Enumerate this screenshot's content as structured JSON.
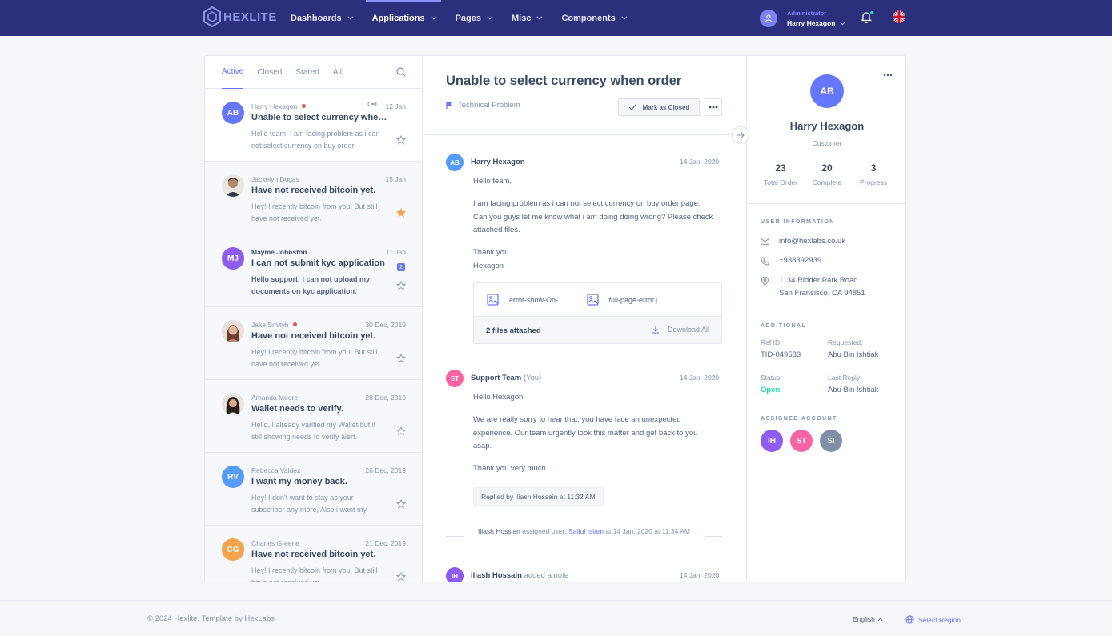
{
  "brand": {
    "name": "HEXLITE"
  },
  "nav": [
    {
      "label": "Dashboards"
    },
    {
      "label": "Applications",
      "active": true
    },
    {
      "label": "Pages"
    },
    {
      "label": "Misc"
    },
    {
      "label": "Components"
    }
  ],
  "user": {
    "role": "Administrator",
    "name": "Harry Hexagon"
  },
  "tabs": [
    {
      "label": "Active",
      "active": true
    },
    {
      "label": "Closed"
    },
    {
      "label": "Stared"
    },
    {
      "label": "All"
    }
  ],
  "messages": [
    {
      "initials": "AB",
      "color": "#6576ff",
      "name": "Harry Hexagon",
      "unread": true,
      "date": "12 Jan",
      "subject": "Unable to select currency when order",
      "snippet": "Hello team, I am facing problem as i can not select currency on buy order",
      "starred": false,
      "attach": true,
      "selected": true
    },
    {
      "initials": "",
      "photo": true,
      "color": "#b5a896",
      "name": "Jackelyn Dugas",
      "date": "15 Jan",
      "subject": "Have not received bitcoin yet.",
      "snippet": "Hey! I recently bitcoin from you. But still have not received yet.",
      "starred": true
    },
    {
      "initials": "MJ",
      "color": "#8e5cf2",
      "name": "Mayme Johnston",
      "date": "11 Jan",
      "subject": "I can not submit kyc application",
      "snippet": "Hello support! I can not upload my documents on kyc application.",
      "starred": false,
      "badge": "2",
      "boldSnippet": true,
      "boldName": true
    },
    {
      "initials": "",
      "photo": true,
      "color": "#c9a58c",
      "name": "Jake Smityh",
      "unread": true,
      "date": "30 Dec, 2019",
      "subject": "Have not received bitcoin yet.",
      "snippet": "Hey! I recently bitcoin from you. But still have not received yet.",
      "starred": false
    },
    {
      "initials": "",
      "photo": true,
      "color": "#7a5f55",
      "name": "Amanda Moore",
      "date": "28 Dec, 2019",
      "subject": "Wallet needs to verify.",
      "snippet": "Hello, I already varified my Wallet but it still showing needs to verify alert.",
      "starred": false
    },
    {
      "initials": "RV",
      "color": "#559bfb",
      "name": "Rebecca Valdez",
      "date": "26 Dec, 2019",
      "subject": "I want my money back.",
      "snippet": "Hey! I don't want to stay as your subscriber any more, Also i want my",
      "starred": false
    },
    {
      "initials": "CG",
      "color": "#f4a24b",
      "name": "Charles Greene",
      "date": "21 Dec, 2019",
      "subject": "Have not received bitcoin yet.",
      "snippet": "Hey! I recently bitcoin from you. But still have not received yet.",
      "starred": false
    }
  ],
  "ticket": {
    "title": "Unable to select currency when order",
    "tag": "Technical Problem",
    "close_label": "Mark as Closed"
  },
  "replies": [
    {
      "initials": "AB",
      "color": "#559bfb",
      "name": "Harry Hexagon",
      "date": "14 Jan, 2020",
      "paras": [
        "Hello team,",
        "I am facing problem as i can not select currency on buy order page. Can you guys let me know what i am doing doing wrong? Please check attached files.",
        "Thank you\nHexagon"
      ]
    },
    {
      "initials": "ST",
      "color": "#ff63a5",
      "name": "Support Team",
      "you": "(You)",
      "date": "14 Jan, 2020",
      "paras": [
        "Hello Hexagon,",
        "We are really sorry to hear that, you have face an unexpected experience. Our team urgently look this matter and get back to you asap.",
        "Thank you very much."
      ],
      "replied": "Replied by Iliash Hossain at 11:32 AM"
    },
    {
      "initials": "IH",
      "color": "#8e5cf2",
      "name": "Iliash Hossain",
      "action": "added a note",
      "date": "14 Jan, 2020"
    }
  ],
  "attachments": {
    "files": [
      "error-show-On-...",
      "full-page-error.j..."
    ],
    "count": "2 files attached",
    "download": "Download All"
  },
  "assign": {
    "actor": "Iliash Hossian",
    "text": "assigned user:",
    "target": "Saiful Islam",
    "when": "at 14 Jan, 2020 at 11:34 AM"
  },
  "profile": {
    "initials": "AB",
    "name": "Harry Hexagon",
    "role": "Customer",
    "stats": [
      {
        "value": "23",
        "label": "Total Order"
      },
      {
        "value": "20",
        "label": "Complete"
      },
      {
        "value": "3",
        "label": "Progress"
      }
    ],
    "info_title": "USER INFORMATION",
    "email": "info@hexlabs.co.uk",
    "phone": "+938392939",
    "address1": "1134 Ridder Park Road",
    "address2": "San Fransisco, CA 94851",
    "additional_title": "ADDITIONAL",
    "ref_label": "Ref ID:",
    "ref": "TID-049583",
    "requested_label": "Requested:",
    "requested": "Abu Bin Ishtiak",
    "status_label": "Status:",
    "status": "Open",
    "lastreply_label": "Last Reply:",
    "lastreply": "Abu Bin Ishtiak",
    "assigned_title": "ASSIGNED ACCOUNT",
    "accounts": [
      {
        "initials": "IH",
        "color": "#8e5cf2"
      },
      {
        "initials": "ST",
        "color": "#ff63a5"
      },
      {
        "initials": "SI",
        "color": "#8091a7"
      }
    ]
  },
  "footer": {
    "copy": "© 2024 Hexlite. Template by HexLabs",
    "lang": "English",
    "region": "Select Region"
  }
}
